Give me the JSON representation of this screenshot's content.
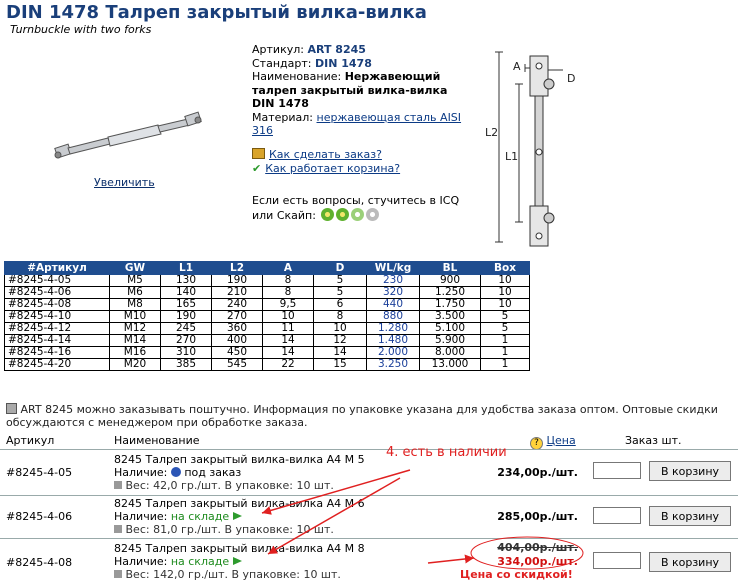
{
  "header": {
    "title": "DIN 1478 Талреп закрытый вилка-вилка",
    "subtitle": "Turnbuckle with two forks"
  },
  "image": {
    "enlarge_label": "Увеличить"
  },
  "specs": {
    "article_label": "Артикул:",
    "article_value": "ART 8245",
    "standard_label": "Стандарт:",
    "standard_value": "DIN 1478",
    "name_label": "Наименование:",
    "name_value": "Нержавеющий талреп закрытый вилка-вилка DIN 1478",
    "material_label": "Материал:",
    "material_value": "нержавеющая сталь AISI 316"
  },
  "links": {
    "how_order": "Как сделать заказ?",
    "how_cart": "Как работает корзина?"
  },
  "contact": {
    "text": "Если есть вопросы, стучитесь в ICQ или Скайп:"
  },
  "drawing": {
    "label_a": "A",
    "label_d": "D",
    "label_l1": "L1",
    "label_l2": "L2"
  },
  "spec_table": {
    "headers": [
      "#Артикул",
      "GW",
      "L1",
      "L2",
      "A",
      "D",
      "WL/kg",
      "BL",
      "Box"
    ],
    "rows": [
      [
        "#8245-4-05",
        "M5",
        "130",
        "190",
        "8",
        "5",
        "230",
        "900",
        "10"
      ],
      [
        "#8245-4-06",
        "M6",
        "140",
        "210",
        "8",
        "5",
        "320",
        "1.250",
        "10"
      ],
      [
        "#8245-4-08",
        "M8",
        "165",
        "240",
        "9,5",
        "6",
        "440",
        "1.750",
        "10"
      ],
      [
        "#8245-4-10",
        "M10",
        "190",
        "270",
        "10",
        "8",
        "880",
        "3.500",
        "5"
      ],
      [
        "#8245-4-12",
        "M12",
        "245",
        "360",
        "11",
        "10",
        "1.280",
        "5.100",
        "5"
      ],
      [
        "#8245-4-14",
        "M14",
        "270",
        "400",
        "14",
        "12",
        "1.480",
        "5.900",
        "1"
      ],
      [
        "#8245-4-16",
        "M16",
        "310",
        "450",
        "14",
        "14",
        "2.000",
        "8.000",
        "1"
      ],
      [
        "#8245-4-20",
        "M20",
        "385",
        "545",
        "22",
        "15",
        "3.250",
        "13.000",
        "1"
      ]
    ]
  },
  "note": {
    "text": "ART 8245 можно заказывать поштучно. Информация по упаковке указана для удобства заказа оптом.  Оптовые скидки обсуждаются с менеджером при обработке заказа."
  },
  "order_header": {
    "col_article": "Артикул",
    "col_name": "Наименование",
    "col_price": "Цена",
    "col_qty": "Заказ шт."
  },
  "order_rows": [
    {
      "article": "#8245-4-05",
      "name": "8245 Талреп закрытый вилка-вилка A4 M 5",
      "stock_label": "Наличие:",
      "stock": "под заказ",
      "weight": "Вес: 42,0 гр./шт. В упаковке: 10 шт.",
      "price": "234,00р./шт.",
      "old_price": "",
      "button": "В корзину"
    },
    {
      "article": "#8245-4-06",
      "name": "8245 Талреп закрытый вилка-вилка A4 M 6",
      "stock_label": "Наличие:",
      "stock": "на складе",
      "weight": "Вес: 81,0 гр./шт. В упаковке: 10 шт.",
      "price": "285,00р./шт.",
      "old_price": "",
      "button": "В корзину"
    },
    {
      "article": "#8245-4-08",
      "name": "8245 Талреп закрытый вилка-вилка A4 M 8",
      "stock_label": "Наличие:",
      "stock": "на складе",
      "weight": "Вес: 142,0 гр./шт. В упаковке: 10 шт.",
      "price": "334,00р./шт.",
      "old_price": "404,00р./шт.",
      "button": "В корзину"
    }
  ],
  "annotations": {
    "in_stock": "4. есть в наличии",
    "discount": "Цена со скидкой!"
  },
  "colors": {
    "accent": "#1f4d8f",
    "annotation": "#e02020",
    "stock_green": "#1d8a1d"
  }
}
